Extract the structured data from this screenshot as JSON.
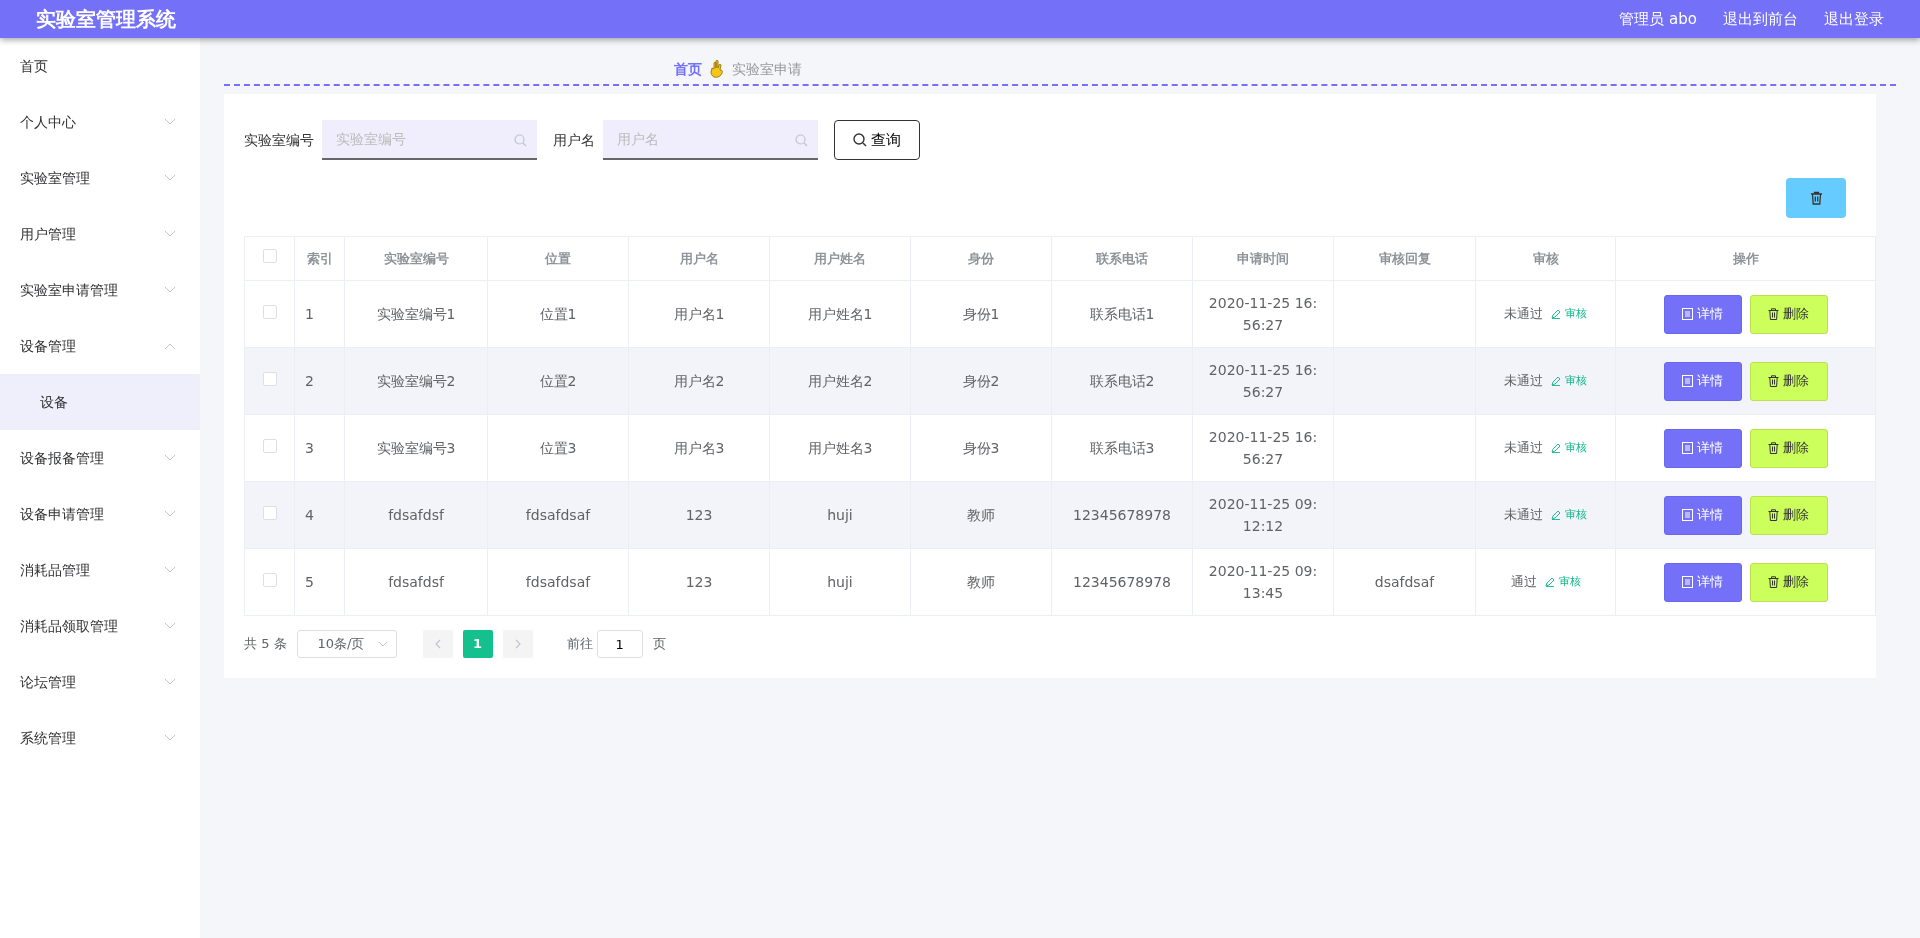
{
  "header": {
    "title": "实验室管理系统",
    "user": "管理员 abo",
    "links": [
      "退出到前台",
      "退出登录"
    ]
  },
  "sidebar": {
    "items": [
      {
        "label": "首页",
        "kind": "link"
      },
      {
        "label": "个人中心",
        "kind": "submenu",
        "expanded": false
      },
      {
        "label": "实验室管理",
        "kind": "submenu",
        "expanded": false
      },
      {
        "label": "用户管理",
        "kind": "submenu",
        "expanded": false
      },
      {
        "label": "实验室申请管理",
        "kind": "submenu",
        "expanded": false
      },
      {
        "label": "设备管理",
        "kind": "submenu",
        "expanded": true,
        "children": [
          {
            "label": "设备",
            "selected": true
          }
        ]
      },
      {
        "label": "设备报备管理",
        "kind": "submenu",
        "expanded": false
      },
      {
        "label": "设备申请管理",
        "kind": "submenu",
        "expanded": false
      },
      {
        "label": "消耗品管理",
        "kind": "submenu",
        "expanded": false
      },
      {
        "label": "消耗品领取管理",
        "kind": "submenu",
        "expanded": false
      },
      {
        "label": "论坛管理",
        "kind": "submenu",
        "expanded": false
      },
      {
        "label": "系统管理",
        "kind": "submenu",
        "expanded": false
      }
    ]
  },
  "breadcrumb": [
    "首页",
    "实验室申请"
  ],
  "search": {
    "fields": [
      {
        "label": "实验室编号",
        "placeholder": "实验室编号"
      },
      {
        "label": "用户名",
        "placeholder": "用户名"
      }
    ],
    "button": "查询"
  },
  "table": {
    "all_checked": false,
    "columns": [
      "索引",
      "实验室编号",
      "位置",
      "用户名",
      "用户姓名",
      "身份",
      "联系电话",
      "申请时间",
      "审核回复",
      "审核",
      "操作"
    ],
    "rows": [
      {
        "checked": false,
        "cells": [
          "1",
          "实验室编号1",
          "位置1",
          "用户名1",
          "用户姓名1",
          "身份1",
          "联系电话1",
          "2020-11-25 16:56:27",
          ""
        ],
        "status": "未通过",
        "review": "审核",
        "actions": [
          "详情",
          "删除"
        ]
      },
      {
        "checked": false,
        "cells": [
          "2",
          "实验室编号2",
          "位置2",
          "用户名2",
          "用户姓名2",
          "身份2",
          "联系电话2",
          "2020-11-25 16:56:27",
          ""
        ],
        "status": "未通过",
        "review": "审核",
        "actions": [
          "详情",
          "删除"
        ]
      },
      {
        "checked": false,
        "cells": [
          "3",
          "实验室编号3",
          "位置3",
          "用户名3",
          "用户姓名3",
          "身份3",
          "联系电话3",
          "2020-11-25 16:56:27",
          ""
        ],
        "status": "未通过",
        "review": "审核",
        "actions": [
          "详情",
          "删除"
        ]
      },
      {
        "checked": false,
        "cells": [
          "4",
          "fdsafdsf",
          "fdsafdsaf",
          "123",
          "huji",
          "教师",
          "12345678978",
          "2020-11-25 09:12:12",
          ""
        ],
        "status": "未通过",
        "review": "审核",
        "actions": [
          "详情",
          "删除"
        ]
      },
      {
        "checked": false,
        "cells": [
          "5",
          "fdsafdsf",
          "fdsafdsaf",
          "123",
          "huji",
          "教师",
          "12345678978",
          "2020-11-25 09:13:45",
          "dsafdsaf"
        ],
        "status": "通过",
        "review": "审核",
        "actions": [
          "详情",
          "删除"
        ]
      }
    ]
  },
  "pagination": {
    "total": "共 5 条",
    "page_size": "10条/页",
    "pages": [
      {
        "label": "1",
        "selected": true
      }
    ],
    "goto_label": "前往",
    "goto_value": "1",
    "goto_suffix": "页"
  }
}
